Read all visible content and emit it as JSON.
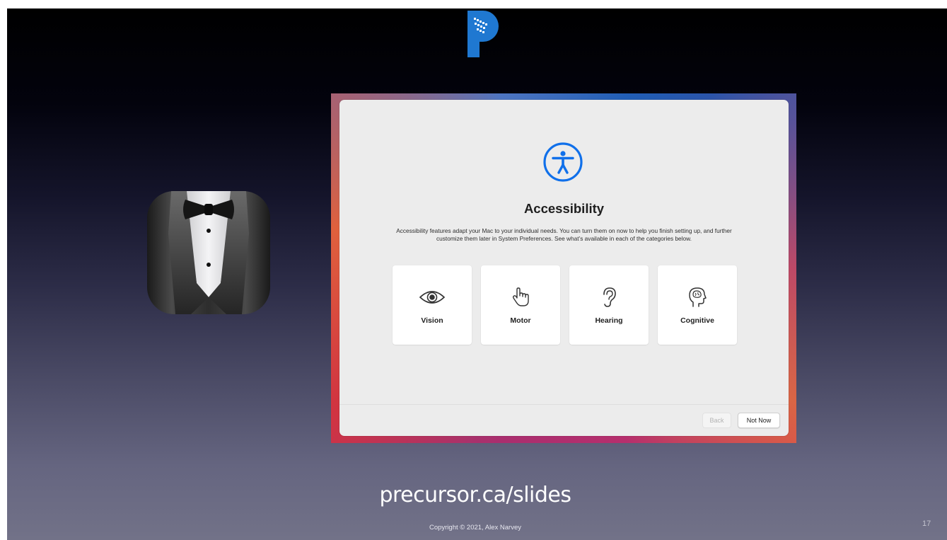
{
  "slide": {
    "url_text": "precursor.ca/slides",
    "copyright": "Copyright © 2021, Alex Narvey",
    "page_number": "17"
  },
  "icons": {
    "logo": "precursor-p-logo",
    "app_icon": "bartender-tuxedo-icon",
    "window_icon": "accessibility-icon"
  },
  "window": {
    "title": "Accessibility",
    "description": "Accessibility features adapt your Mac to your individual needs. You can turn them on now to help you finish setting up, and further customize them later in System Preferences. See what’s available in each of the categories below.",
    "categories": [
      {
        "label": "Vision",
        "icon": "eye-icon"
      },
      {
        "label": "Motor",
        "icon": "pointing-hand-icon"
      },
      {
        "label": "Hearing",
        "icon": "ear-icon"
      },
      {
        "label": "Cognitive",
        "icon": "head-brain-icon"
      }
    ],
    "buttons": {
      "back": "Back",
      "not_now": "Not Now"
    }
  },
  "colors": {
    "accent": "#1070ea",
    "window_bg": "#ececec"
  }
}
